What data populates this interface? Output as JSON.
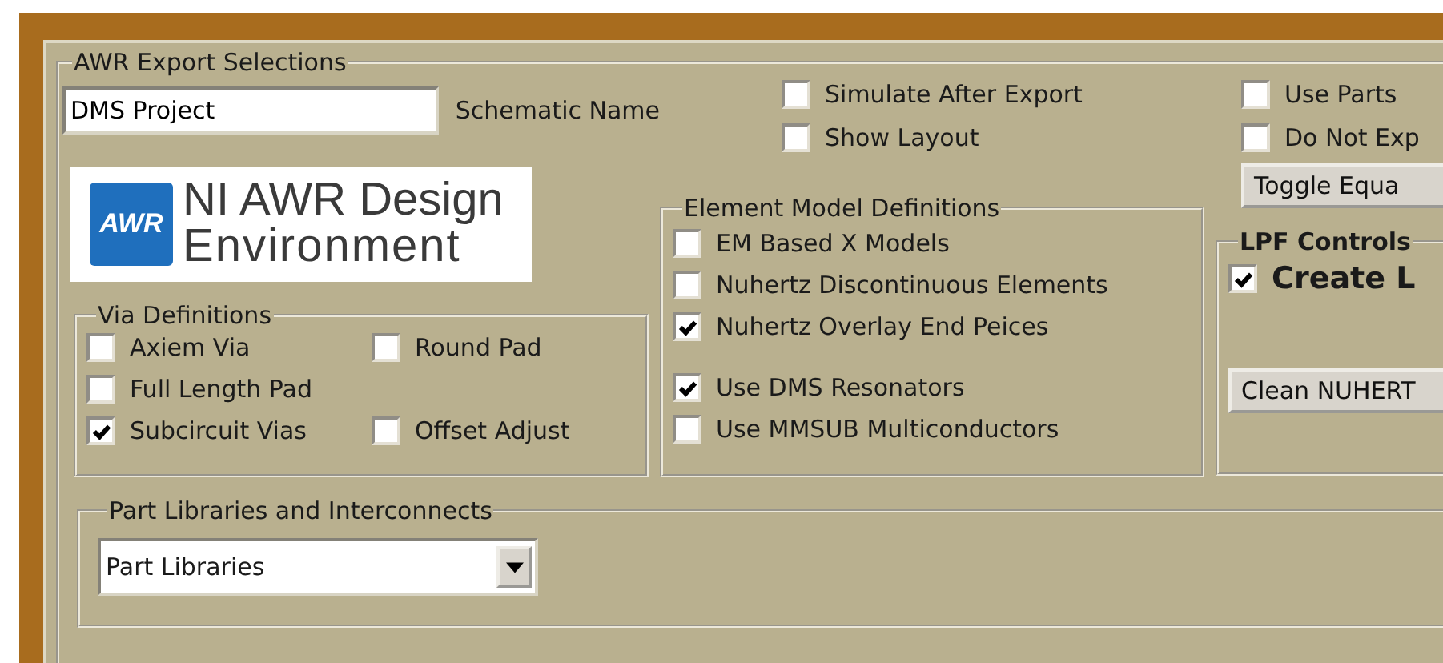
{
  "export_group": {
    "title": "AWR Export Selections",
    "schematic": {
      "value": "DMS Project",
      "label": "Schematic Name"
    },
    "options": [
      {
        "label": "Simulate After Export",
        "checked": false
      },
      {
        "label": "Show Layout",
        "checked": false
      }
    ],
    "options_right": [
      {
        "label": "Use Parts",
        "checked": false
      },
      {
        "label": "Do Not Exp",
        "checked": false
      }
    ],
    "toggle_button": "Toggle Equa",
    "logo": {
      "badge": "AWR",
      "line1": "NI AWR Design",
      "line2": "Environment"
    },
    "via_group": {
      "title": "Via Definitions",
      "columns": [
        [
          {
            "label": "Axiem Via",
            "checked": false
          },
          {
            "label": "Full Length Pad",
            "checked": false
          },
          {
            "label": "Subcircuit Vias",
            "checked": true
          }
        ],
        [
          {
            "label": "Round Pad",
            "checked": false
          },
          {
            "label": "Offset Adjust",
            "checked": false
          }
        ]
      ]
    },
    "element_group": {
      "title": "Element Model Definitions",
      "items": [
        {
          "label": "EM Based X Models",
          "checked": false
        },
        {
          "label": "Nuhertz Discontinuous Elements",
          "checked": false
        },
        {
          "label": "Nuhertz Overlay End Peices",
          "checked": true
        },
        {
          "label": "Use DMS Resonators",
          "checked": true
        },
        {
          "label": "Use MMSUB Multiconductors",
          "checked": false
        }
      ]
    },
    "lpf_group": {
      "title": "LPF Controls",
      "create": {
        "label": "Create L",
        "checked": true
      },
      "clean_button": "Clean NUHERT"
    },
    "parts_group": {
      "title": "Part Libraries and Interconnects",
      "dropdown": {
        "value": "Part Libraries"
      }
    }
  }
}
